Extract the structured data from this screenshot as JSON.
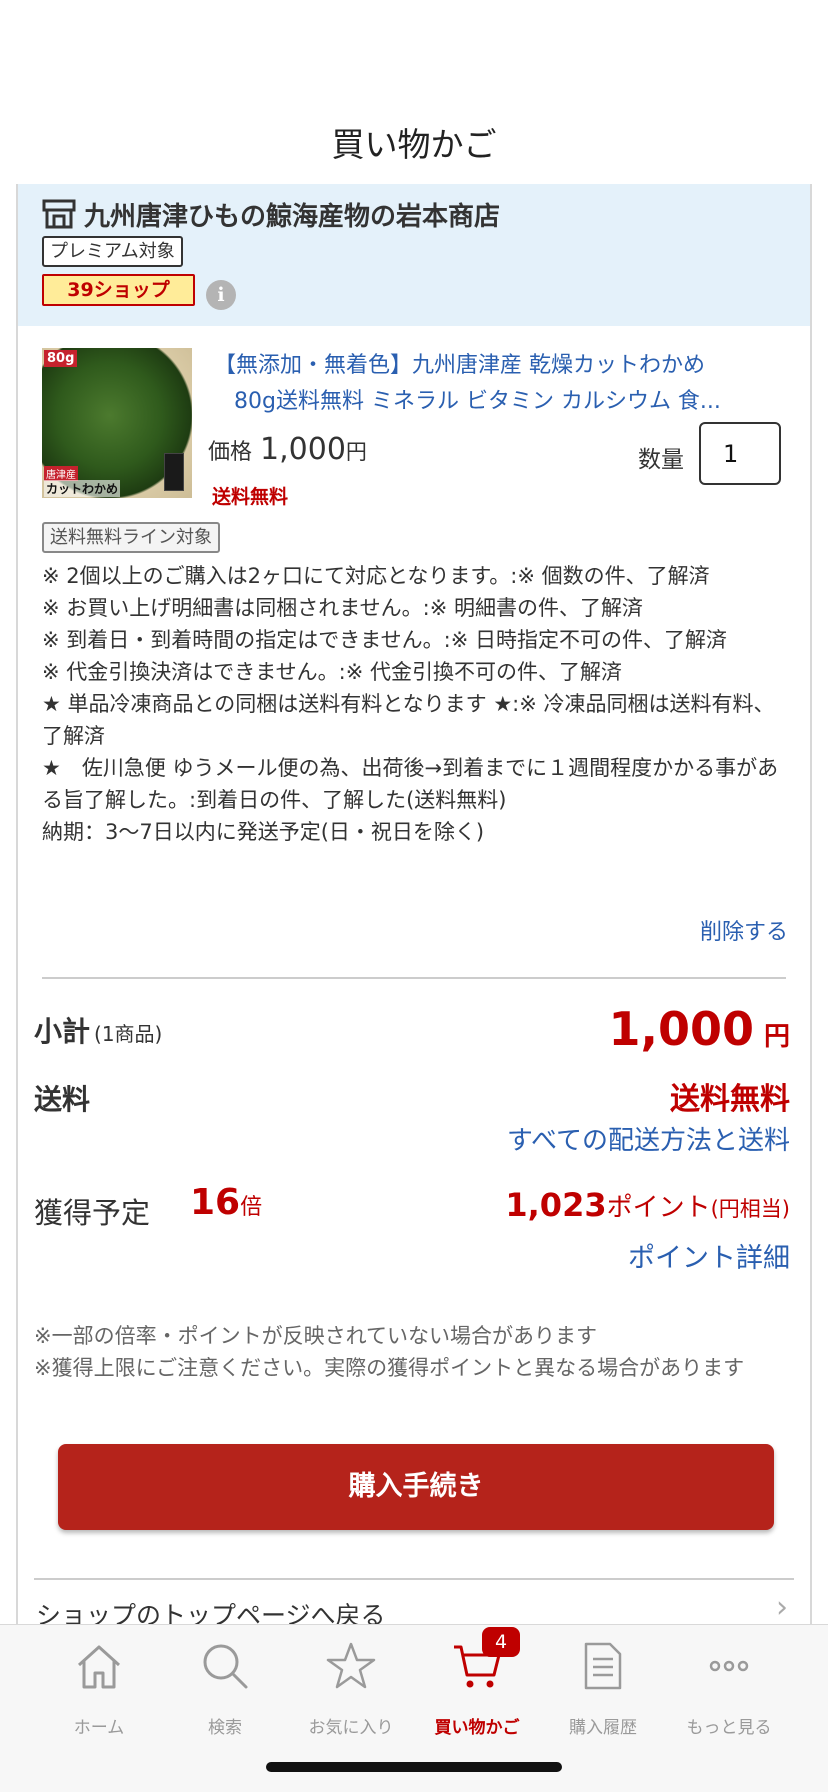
{
  "header": {
    "title": "買い物かご"
  },
  "shop": {
    "name": "九州唐津ひもの鯨海産物の岩本商店",
    "icon": "shop-icon",
    "premium_badge": "プレミアム対象",
    "shop39_badge": "39ショップ",
    "info_icon_glyph": "i"
  },
  "product": {
    "title_line1": "【無添加・無着色】九州唐津産 乾燥カットわかめ",
    "title_line2": "80g送料無料 ミネラル ビタミン カルシウム 食...",
    "thumbnail": {
      "weight_label": "80g",
      "origin_label": "唐津産",
      "name_label": "カットわかめ"
    },
    "price_label": "価格",
    "price_value": "1,000",
    "price_unit": "円",
    "shipping_note": "送料無料",
    "quantity_label": "数量",
    "quantity_value": "1",
    "free_shipping_badge": "送料無料ライン対象",
    "notes": [
      "※ 2個以上のご購入は2ヶ口にて対応となります。:※ 個数の件、了解済",
      "※ お買い上げ明細書は同梱されません。:※ 明細書の件、了解済",
      "※ 到着日・到着時間の指定はできません。:※ 日時指定不可の件、了解済",
      "※ 代金引換決済はできません。:※ 代金引換不可の件、了解済",
      "★ 単品冷凍商品との同梱は送料有料となります ★:※ 冷凍品同梱は送料有料、了解済",
      "★　佐川急便 ゆうメール便の為、出荷後→到着までに１週間程度かかる事がある旨了解した。:到着日の件、了解した(送料無料)",
      "納期：3〜7日以内に発送予定(日・祝日を除く)"
    ],
    "delete_label": "削除する"
  },
  "summary": {
    "subtotal_label": "小計",
    "subtotal_count": "(1商品)",
    "subtotal_value": "1,000",
    "subtotal_unit": "円",
    "shipping_label": "送料",
    "shipping_value": "送料無料",
    "shipping_methods_link": "すべての配送方法と送料",
    "points_label": "獲得予定",
    "points_multiplier": "16",
    "points_multiplier_unit": "倍",
    "points_value": "1,023",
    "points_unit": "ポイント",
    "points_yen_note": "(円相当)",
    "points_detail_link": "ポイント詳細"
  },
  "disclaimers": [
    "※一部の倍率・ポイントが反映されていない場合があります",
    "※獲得上限にご注意ください。実際の獲得ポイントと異なる場合があります"
  ],
  "checkout_button": "購入手続き",
  "shop_top_link": "ショップのトップページへ戻る",
  "shop_top_chevron": "›",
  "tabbar": {
    "items": [
      {
        "label": "ホーム",
        "icon": "home-icon"
      },
      {
        "label": "検索",
        "icon": "search-icon"
      },
      {
        "label": "お気に入り",
        "icon": "star-icon"
      },
      {
        "label": "買い物かご",
        "icon": "cart-icon",
        "badge": "4",
        "active": true
      },
      {
        "label": "購入履歴",
        "icon": "document-icon"
      },
      {
        "label": "もっと見る",
        "icon": "more-icon"
      }
    ]
  },
  "colors": {
    "accent_red": "#bf0000",
    "link_blue": "#2a5fb0",
    "shop_header_bg": "#e4f1fa",
    "checkout_button": "#b5231b",
    "badge_yellow": "#ffec99"
  }
}
